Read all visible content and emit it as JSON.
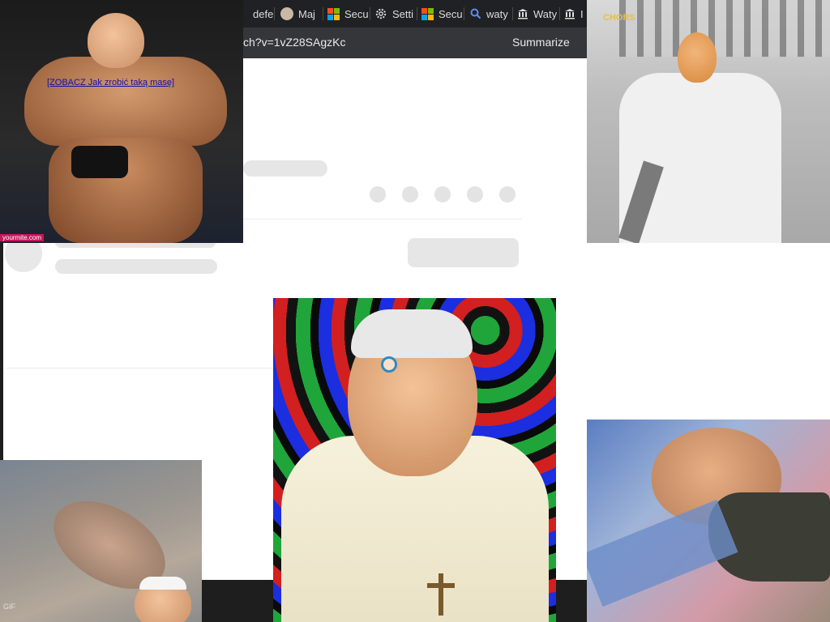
{
  "browser": {
    "tabs": [
      {
        "label": "defe",
        "icon": "none"
      },
      {
        "label": "Maj",
        "icon": "avatar-icon"
      },
      {
        "label": "Secu",
        "icon": "microsoft-icon"
      },
      {
        "label": "Setti",
        "icon": "gear-icon"
      },
      {
        "label": "Secu",
        "icon": "microsoft-icon"
      },
      {
        "label": "waty",
        "icon": "search-icon"
      },
      {
        "label": "Waty",
        "icon": "museum-icon"
      },
      {
        "label": "I",
        "icon": "museum-icon"
      }
    ],
    "url_fragment": "ch?v=1vZ28SAgzKc",
    "summarize_label": "Summarize"
  },
  "overlays": {
    "bodybuilder_link": "[ZOBACZ Jak zrobić taką masę]",
    "bodybuilder_watermark": "yourmite.com",
    "butcher_caption": "CHORS",
    "bottom_left_watermark": "GIF"
  },
  "colors": {
    "tab_bg": "#202124",
    "address_bg": "#35363a",
    "skeleton": "#e6e6e6",
    "link": "#1a0dab",
    "cursor_ring": "#2e8bc0"
  }
}
